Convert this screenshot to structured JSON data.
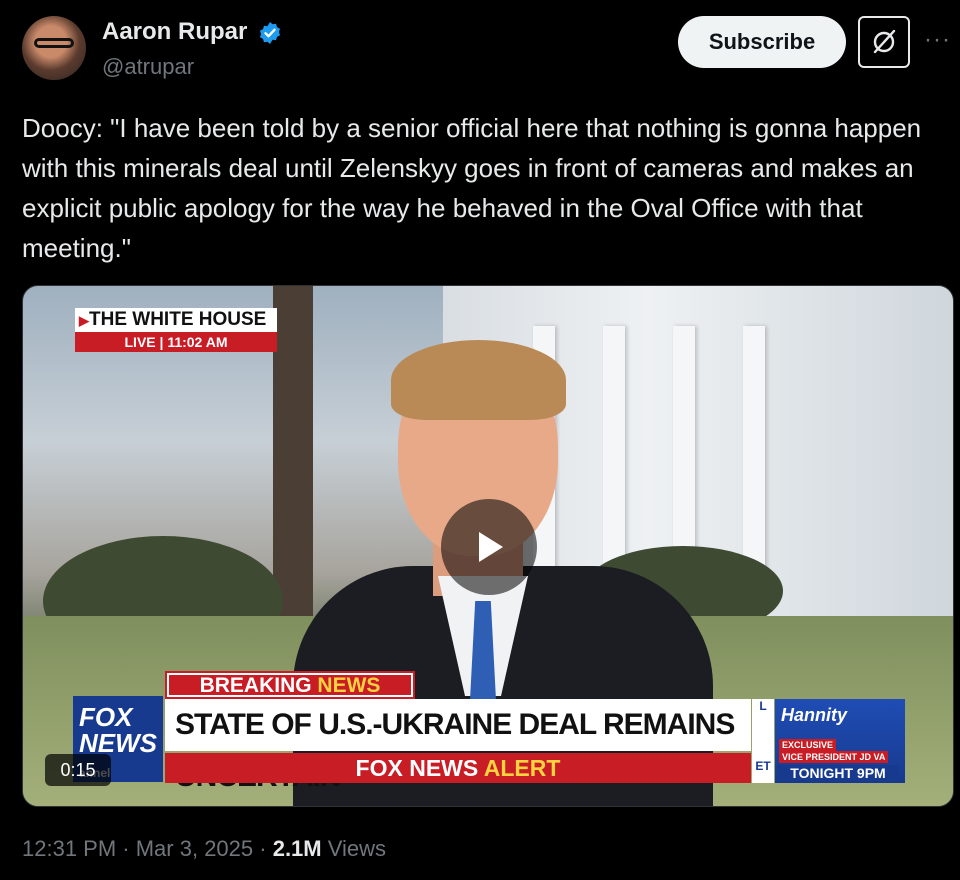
{
  "author": {
    "name": "Aaron Rupar",
    "handle": "@atrupar",
    "verified_icon": "verified-badge-icon",
    "verified_color": "#1d9bf0"
  },
  "actions": {
    "subscribe_label": "Subscribe",
    "grok_icon": "grok-icon",
    "more_icon": "more-icon",
    "more_glyph": "···"
  },
  "tweet": {
    "text": "Doocy: \"I have been told by a senior official here that nothing is gonna happen with this minerals deal until Zelenskyy goes in front of cameras and makes an explicit public apology for the way he behaved in the Oval Office with that meeting.\""
  },
  "video": {
    "duration": "0:15",
    "location_label": "THE WHITE HOUSE",
    "live_label": "LIVE | 11:02 AM",
    "breaking_word": "BREAKING",
    "news_word": "NEWS",
    "logo_line1": "FOX",
    "logo_line2": "NEWS",
    "logo_line3": "annel",
    "headline": "STATE OF U.S.-UKRAINE DEAL REMAINS UNCERTAIN",
    "alert_brand": "FOX NEWS",
    "alert_word": "ALERT",
    "promo_show": "Hannity",
    "promo_exclusive": "EXCLUSIVE",
    "promo_guest": "VICE PRESIDENT JD VA",
    "promo_time": "TONIGHT 9PM",
    "strip_top": "L",
    "strip_bottom": "ET",
    "play_icon": "play-icon"
  },
  "footer": {
    "time": "12:31 PM",
    "sep1": " · ",
    "date": "Mar 3, 2025",
    "sep2": " · ",
    "views_count": "2.1M",
    "views_label": " Views"
  }
}
